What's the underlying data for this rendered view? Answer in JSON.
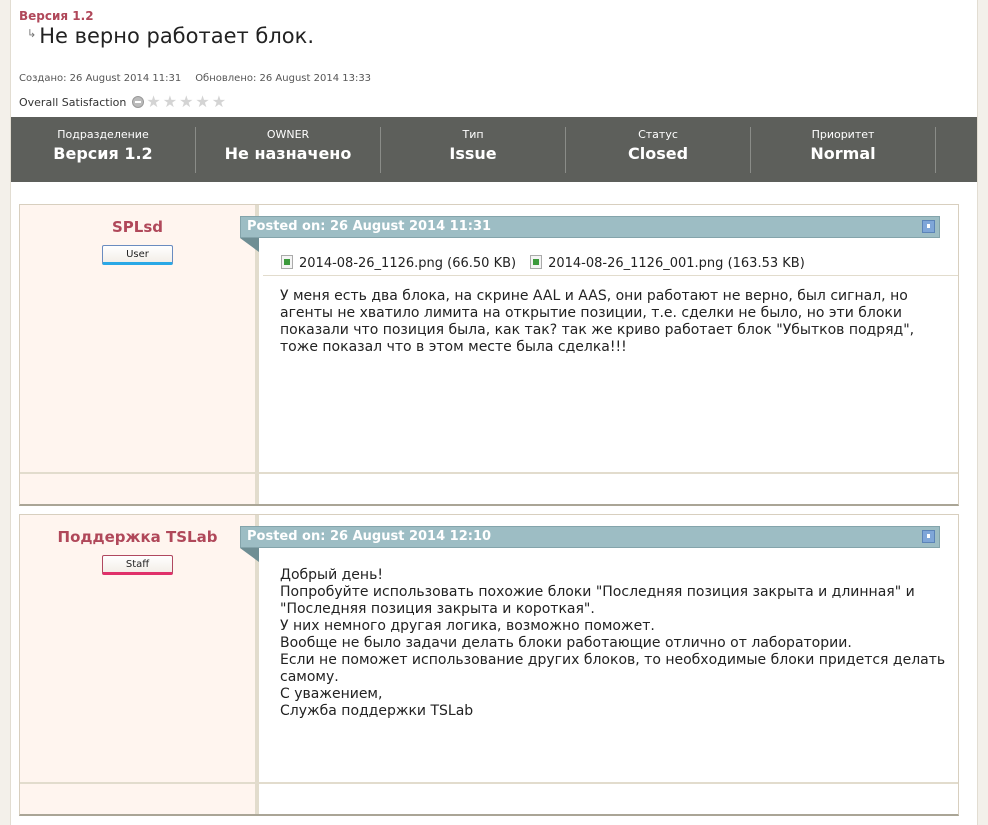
{
  "category": "Версия 1.2",
  "title": "Не верно работает блок.",
  "created": "Создано: 26 August 2014 11:31",
  "updated": "Обновлено: 26 August 2014 13:33",
  "satisfaction_label": "Overall Satisfaction",
  "satisfaction_rating": 0,
  "fields": [
    {
      "label": "Подразделение",
      "value": "Версия 1.2"
    },
    {
      "label": "OWNER",
      "value": "Не назначено"
    },
    {
      "label": "Тип",
      "value": "Issue"
    },
    {
      "label": "Статус",
      "value": "Closed"
    },
    {
      "label": "Приоритет",
      "value": "Normal"
    }
  ],
  "posts": [
    {
      "author": "SPLsd",
      "role": "User",
      "posted": "Posted on: 26 August 2014 11:31",
      "attachments": [
        {
          "name": "2014-08-26_1126.png",
          "size": "(66.50 KB)"
        },
        {
          "name": "2014-08-26_1126_001.png",
          "size": "(163.53 KB)"
        }
      ],
      "text": "У меня есть два блока, на скрине AAL и AAS, они работают не верно, был сигнал, но агенты не хватило лимита на открытие позиции, т.е. сделки не было, но эти блоки показали что позиция была, как так? так же криво работает блок \"Убытков подряд\", тоже показал что в этом месте была сделка!!!"
    },
    {
      "author": "Поддержка TSLab",
      "role": "Staff",
      "posted": "Posted on: 26 August 2014 12:10",
      "text": "Добрый день!\nПопробуйте использовать похожие блоки \"Последняя позиция закрыта и длинная\" и \"Последняя позиция закрыта и короткая\".\nУ них немного другая логика, возможно поможет.\nВообще не было задачи делать блоки работающие отлично от лаборатории.\nЕсли не поможет использование других блоков, то необходимые блоки придется делать самому.\nС уважением,\nСлужба поддержки TSLab"
    }
  ]
}
